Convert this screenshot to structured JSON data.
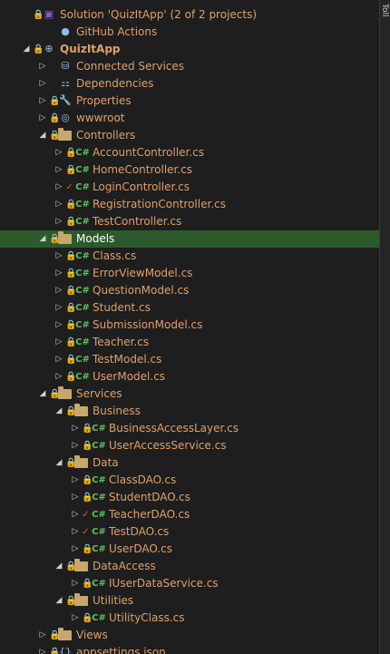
{
  "solution_explorer": {
    "items": [
      {
        "label": "Solution 'QuizItApp' (2 of 2 projects)",
        "icon": "solution-icon",
        "depth": 0,
        "arrow": "",
        "lock": true,
        "check": false
      },
      {
        "label": "GitHub Actions",
        "icon": "github-icon",
        "depth": 1,
        "arrow": "",
        "lock": false,
        "check": false
      },
      {
        "label": "QuizItApp",
        "icon": "web-project-icon",
        "depth": 0,
        "arrow": "expanded",
        "lock": true,
        "check": false,
        "bold": true
      },
      {
        "label": "Connected Services",
        "icon": "connected-services-icon",
        "depth": 1,
        "arrow": "collapsed",
        "lock": false,
        "check": false
      },
      {
        "label": "Dependencies",
        "icon": "dependencies-icon",
        "depth": 1,
        "arrow": "collapsed",
        "lock": false,
        "check": false
      },
      {
        "label": "Properties",
        "icon": "properties-icon",
        "depth": 1,
        "arrow": "collapsed",
        "lock": true,
        "check": false
      },
      {
        "label": "wwwroot",
        "icon": "globe-icon",
        "depth": 1,
        "arrow": "collapsed",
        "lock": true,
        "check": false
      },
      {
        "label": "Controllers",
        "icon": "folder-icon",
        "depth": 1,
        "arrow": "expanded",
        "lock": true,
        "check": false
      },
      {
        "label": "AccountController.cs",
        "icon": "csharp-icon",
        "depth": 2,
        "arrow": "collapsed",
        "lock": true,
        "check": false
      },
      {
        "label": "HomeController.cs",
        "icon": "csharp-icon",
        "depth": 2,
        "arrow": "collapsed",
        "lock": true,
        "check": false
      },
      {
        "label": "LoginController.cs",
        "icon": "csharp-icon",
        "depth": 2,
        "arrow": "collapsed",
        "lock": false,
        "check": true
      },
      {
        "label": "RegistrationController.cs",
        "icon": "csharp-icon",
        "depth": 2,
        "arrow": "collapsed",
        "lock": true,
        "check": false
      },
      {
        "label": "TestController.cs",
        "icon": "csharp-icon",
        "depth": 2,
        "arrow": "collapsed",
        "lock": true,
        "check": false
      },
      {
        "label": "Models",
        "icon": "folder-icon",
        "depth": 1,
        "arrow": "expanded",
        "lock": true,
        "check": false,
        "selected": true
      },
      {
        "label": "Class.cs",
        "icon": "csharp-icon",
        "depth": 2,
        "arrow": "collapsed",
        "lock": true,
        "check": false
      },
      {
        "label": "ErrorViewModel.cs",
        "icon": "csharp-icon",
        "depth": 2,
        "arrow": "collapsed",
        "lock": true,
        "check": false
      },
      {
        "label": "QuestionModel.cs",
        "icon": "csharp-icon",
        "depth": 2,
        "arrow": "collapsed",
        "lock": true,
        "check": false
      },
      {
        "label": "Student.cs",
        "icon": "csharp-icon",
        "depth": 2,
        "arrow": "collapsed",
        "lock": true,
        "check": false
      },
      {
        "label": "SubmissionModel.cs",
        "icon": "csharp-icon",
        "depth": 2,
        "arrow": "collapsed",
        "lock": true,
        "check": false
      },
      {
        "label": "Teacher.cs",
        "icon": "csharp-icon",
        "depth": 2,
        "arrow": "collapsed",
        "lock": true,
        "check": false
      },
      {
        "label": "TestModel.cs",
        "icon": "csharp-icon",
        "depth": 2,
        "arrow": "collapsed",
        "lock": true,
        "check": false
      },
      {
        "label": "UserModel.cs",
        "icon": "csharp-icon",
        "depth": 2,
        "arrow": "collapsed",
        "lock": true,
        "check": false
      },
      {
        "label": "Services",
        "icon": "folder-icon",
        "depth": 1,
        "arrow": "expanded",
        "lock": true,
        "check": false
      },
      {
        "label": "Business",
        "icon": "folder-icon",
        "depth": 2,
        "arrow": "expanded",
        "lock": true,
        "check": false
      },
      {
        "label": "BusinessAccessLayer.cs",
        "icon": "csharp-icon",
        "depth": 3,
        "arrow": "collapsed",
        "lock": true,
        "check": false
      },
      {
        "label": "UserAccessService.cs",
        "icon": "csharp-icon",
        "depth": 3,
        "arrow": "collapsed",
        "lock": true,
        "check": false
      },
      {
        "label": "Data",
        "icon": "folder-icon",
        "depth": 2,
        "arrow": "expanded",
        "lock": true,
        "check": false
      },
      {
        "label": "ClassDAO.cs",
        "icon": "csharp-icon",
        "depth": 3,
        "arrow": "collapsed",
        "lock": true,
        "check": false
      },
      {
        "label": "StudentDAO.cs",
        "icon": "csharp-icon",
        "depth": 3,
        "arrow": "collapsed",
        "lock": true,
        "check": false
      },
      {
        "label": "TeacherDAO.cs",
        "icon": "csharp-icon",
        "depth": 3,
        "arrow": "collapsed",
        "lock": false,
        "check": true
      },
      {
        "label": "TestDAO.cs",
        "icon": "csharp-icon",
        "depth": 3,
        "arrow": "collapsed",
        "lock": false,
        "check": true
      },
      {
        "label": "UserDAO.cs",
        "icon": "csharp-icon",
        "depth": 3,
        "arrow": "collapsed",
        "lock": true,
        "check": false
      },
      {
        "label": "DataAccess",
        "icon": "folder-icon",
        "depth": 2,
        "arrow": "expanded",
        "lock": true,
        "check": false
      },
      {
        "label": "IUserDataService.cs",
        "icon": "csharp-icon",
        "depth": 3,
        "arrow": "collapsed",
        "lock": true,
        "check": false
      },
      {
        "label": "Utilities",
        "icon": "folder-icon",
        "depth": 2,
        "arrow": "expanded",
        "lock": true,
        "check": false
      },
      {
        "label": "UtilityClass.cs",
        "icon": "csharp-icon",
        "depth": 3,
        "arrow": "collapsed",
        "lock": true,
        "check": false
      },
      {
        "label": "Views",
        "icon": "folder-icon",
        "depth": 1,
        "arrow": "collapsed",
        "lock": true,
        "check": false
      },
      {
        "label": "appsettings.json",
        "icon": "json-icon",
        "depth": 1,
        "arrow": "collapsed",
        "lock": true,
        "check": false
      }
    ]
  },
  "side_tab": {
    "label": "Toll"
  },
  "colors": {
    "label": "#e0a06a",
    "selected_bg": "#2d5a2d",
    "lock": "#7aa8ff",
    "csharp": "#5fbf5f",
    "folder": "#c8a86a",
    "check": "#e05050"
  }
}
